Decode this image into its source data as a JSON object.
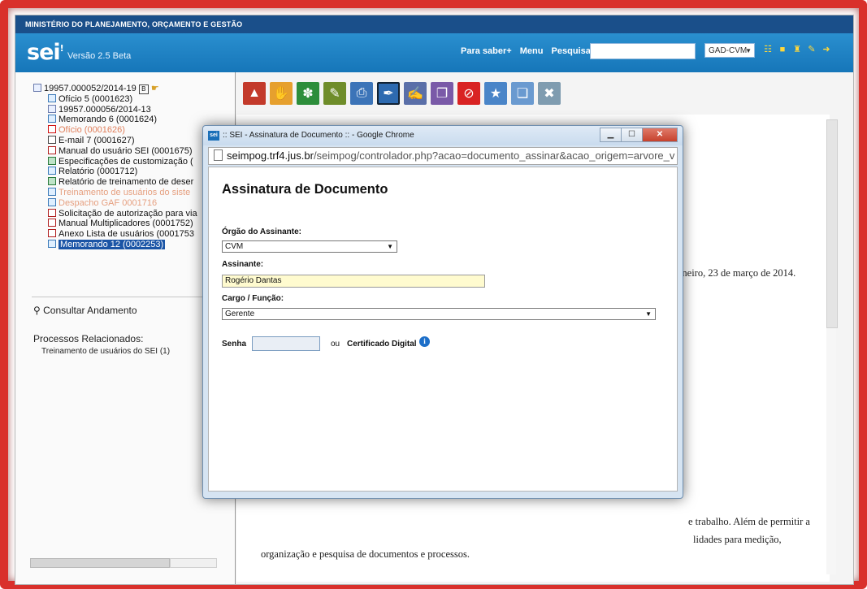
{
  "topbar": {
    "org": "MINISTÉRIO DO PLANEJAMENTO, ORÇAMENTO E GESTÃO"
  },
  "header": {
    "logo": "sei",
    "version": "Versão 2.5 Beta",
    "links": [
      "Para saber+",
      "Menu",
      "Pesquisa"
    ],
    "unit_select": "GAD-CVM"
  },
  "tree": {
    "process": "19957.000052/2014-19",
    "items": [
      {
        "label": "Ofício 5 (0001623)",
        "icon": "document-icon",
        "style": "normal"
      },
      {
        "label": "19957.000056/2014-13",
        "icon": "process-icon",
        "style": "normal"
      },
      {
        "label": "Memorando 6 (0001624)",
        "icon": "document-icon",
        "style": "normal"
      },
      {
        "label": "Ofício (0001626)",
        "icon": "cancelled-icon",
        "style": "cancelled"
      },
      {
        "label": "E-mail 7 (0001627)",
        "icon": "email-icon",
        "style": "normal"
      },
      {
        "label": "Manual do usuário SEI (0001675)",
        "icon": "pdf-icon",
        "style": "normal"
      },
      {
        "label": "Especificações de customização (",
        "icon": "table-icon",
        "style": "normal"
      },
      {
        "label": "Relatório (0001712)",
        "icon": "document-icon",
        "style": "normal"
      },
      {
        "label": "Relatório de treinamento de deser",
        "icon": "table-icon",
        "style": "normal"
      },
      {
        "label": "Treinamento de usuários do siste",
        "icon": "document-icon",
        "style": "faded"
      },
      {
        "label": "Despacho GAF 0001716",
        "icon": "document-icon",
        "style": "faded"
      },
      {
        "label": "Solicitação de autorização para via",
        "icon": "pdf-icon",
        "style": "normal"
      },
      {
        "label": "Manual Multiplicadores (0001752)",
        "icon": "pdf-icon",
        "style": "normal"
      },
      {
        "label": "Anexo Lista de usuários (0001753",
        "icon": "pdf-icon",
        "style": "normal"
      },
      {
        "label": "Memorando 12 (0002253)",
        "icon": "document-icon",
        "style": "selected"
      }
    ],
    "consultar": "Consultar Andamento",
    "related_title": "Processos Relacionados:",
    "related_item": "Treinamento de usuários do SEI (1)"
  },
  "content": {
    "date": "Janeiro, 23 de março de 2014.",
    "line1": "e trabalho. Além de permitir a",
    "line2": "lidades para medição,",
    "line3": "organização e pesquisa de documentos e processos."
  },
  "popup": {
    "window_title": ":: SEI - Assinatura de Documento :: - Google Chrome",
    "url_host": "seimpog.trf4.jus.br",
    "url_path": "/seimpog/controlador.php?acao=documento_assinar&acao_origem=arvore_v",
    "heading": "Assinatura de Documento",
    "orgao_label": "Órgão do Assinante:",
    "orgao_value": "CVM",
    "assinante_label": "Assinante:",
    "assinante_value": "Rogério Dantas",
    "cargo_label": "Cargo / Função:",
    "cargo_value": "Gerente",
    "senha_label": "Senha",
    "ou": "ou",
    "certificado": "Certificado Digital"
  }
}
